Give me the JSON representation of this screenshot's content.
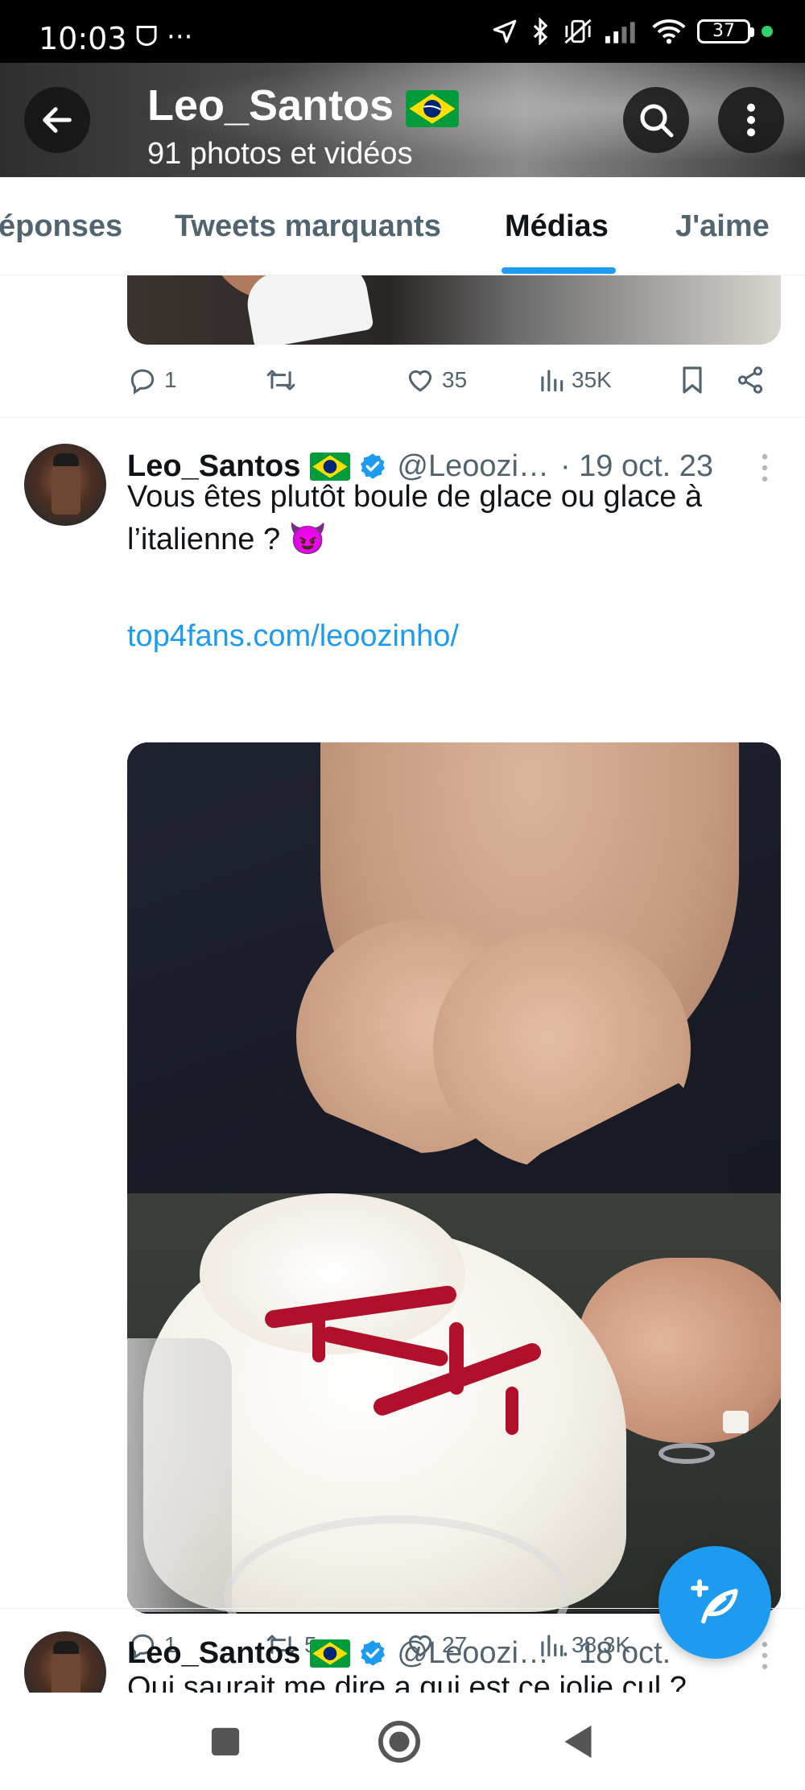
{
  "status_bar": {
    "time": "10:03",
    "left_icons": "ᗜ ···",
    "battery": "37"
  },
  "header": {
    "title": "Leo_Santos",
    "subtitle": "91 photos et vidéos"
  },
  "tabs": [
    {
      "label": "éponses"
    },
    {
      "label": "Tweets marquants"
    },
    {
      "label": "Médias"
    },
    {
      "label": "J'aime"
    }
  ],
  "active_tab": "Médias",
  "prev_tweet": {
    "replies": "1",
    "retweets": "",
    "likes": "35",
    "views": "35K"
  },
  "tweet1": {
    "name": "Leo_Santos",
    "handle": "@Leoozi…",
    "date": "· 19 oct. 23",
    "text_line1": "Vous êtes plutôt boule de glace ou glace à",
    "text_line2": "l’italienne ? 😈",
    "link": "top4fans.com/leoozinho/",
    "replies": "1",
    "retweets": "5",
    "likes": "27",
    "views": "38,3K"
  },
  "tweet2": {
    "name": "Leo_Santos",
    "handle": "@Leoozi…",
    "date": "· 18 oct.",
    "text": "Qui saurait  me dire a qui est ce jolie cul ?"
  },
  "colors": {
    "accent": "#1d9bf0",
    "text": "#0f1419",
    "secondary": "#536471",
    "verified": "#1d9bf0"
  },
  "icons": {
    "back": "arrow-left-icon",
    "search": "search-icon",
    "more": "more-vertical-icon",
    "reply": "reply-icon",
    "retweet": "retweet-icon",
    "like": "heart-icon",
    "views": "views-icon",
    "bookmark": "bookmark-icon",
    "share": "share-icon",
    "compose": "compose-icon"
  }
}
